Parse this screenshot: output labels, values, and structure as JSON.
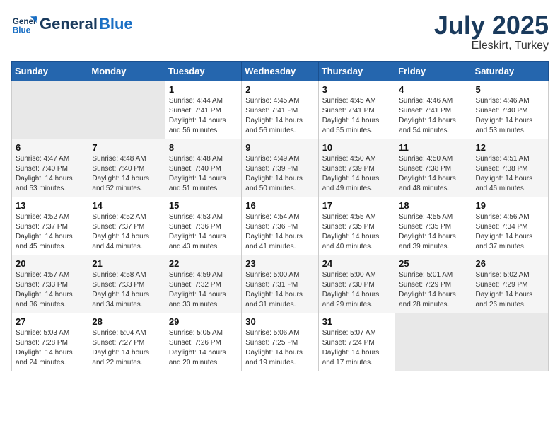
{
  "header": {
    "logo_line1": "General",
    "logo_line2": "Blue",
    "month": "July 2025",
    "location": "Eleskirt, Turkey"
  },
  "weekdays": [
    "Sunday",
    "Monday",
    "Tuesday",
    "Wednesday",
    "Thursday",
    "Friday",
    "Saturday"
  ],
  "weeks": [
    [
      {
        "day": "",
        "empty": true
      },
      {
        "day": "",
        "empty": true
      },
      {
        "day": "1",
        "sunrise": "4:44 AM",
        "sunset": "7:41 PM",
        "daylight": "14 hours and 56 minutes."
      },
      {
        "day": "2",
        "sunrise": "4:45 AM",
        "sunset": "7:41 PM",
        "daylight": "14 hours and 56 minutes."
      },
      {
        "day": "3",
        "sunrise": "4:45 AM",
        "sunset": "7:41 PM",
        "daylight": "14 hours and 55 minutes."
      },
      {
        "day": "4",
        "sunrise": "4:46 AM",
        "sunset": "7:41 PM",
        "daylight": "14 hours and 54 minutes."
      },
      {
        "day": "5",
        "sunrise": "4:46 AM",
        "sunset": "7:40 PM",
        "daylight": "14 hours and 53 minutes."
      }
    ],
    [
      {
        "day": "6",
        "sunrise": "4:47 AM",
        "sunset": "7:40 PM",
        "daylight": "14 hours and 53 minutes."
      },
      {
        "day": "7",
        "sunrise": "4:48 AM",
        "sunset": "7:40 PM",
        "daylight": "14 hours and 52 minutes."
      },
      {
        "day": "8",
        "sunrise": "4:48 AM",
        "sunset": "7:40 PM",
        "daylight": "14 hours and 51 minutes."
      },
      {
        "day": "9",
        "sunrise": "4:49 AM",
        "sunset": "7:39 PM",
        "daylight": "14 hours and 50 minutes."
      },
      {
        "day": "10",
        "sunrise": "4:50 AM",
        "sunset": "7:39 PM",
        "daylight": "14 hours and 49 minutes."
      },
      {
        "day": "11",
        "sunrise": "4:50 AM",
        "sunset": "7:38 PM",
        "daylight": "14 hours and 48 minutes."
      },
      {
        "day": "12",
        "sunrise": "4:51 AM",
        "sunset": "7:38 PM",
        "daylight": "14 hours and 46 minutes."
      }
    ],
    [
      {
        "day": "13",
        "sunrise": "4:52 AM",
        "sunset": "7:37 PM",
        "daylight": "14 hours and 45 minutes."
      },
      {
        "day": "14",
        "sunrise": "4:52 AM",
        "sunset": "7:37 PM",
        "daylight": "14 hours and 44 minutes."
      },
      {
        "day": "15",
        "sunrise": "4:53 AM",
        "sunset": "7:36 PM",
        "daylight": "14 hours and 43 minutes."
      },
      {
        "day": "16",
        "sunrise": "4:54 AM",
        "sunset": "7:36 PM",
        "daylight": "14 hours and 41 minutes."
      },
      {
        "day": "17",
        "sunrise": "4:55 AM",
        "sunset": "7:35 PM",
        "daylight": "14 hours and 40 minutes."
      },
      {
        "day": "18",
        "sunrise": "4:55 AM",
        "sunset": "7:35 PM",
        "daylight": "14 hours and 39 minutes."
      },
      {
        "day": "19",
        "sunrise": "4:56 AM",
        "sunset": "7:34 PM",
        "daylight": "14 hours and 37 minutes."
      }
    ],
    [
      {
        "day": "20",
        "sunrise": "4:57 AM",
        "sunset": "7:33 PM",
        "daylight": "14 hours and 36 minutes."
      },
      {
        "day": "21",
        "sunrise": "4:58 AM",
        "sunset": "7:33 PM",
        "daylight": "14 hours and 34 minutes."
      },
      {
        "day": "22",
        "sunrise": "4:59 AM",
        "sunset": "7:32 PM",
        "daylight": "14 hours and 33 minutes."
      },
      {
        "day": "23",
        "sunrise": "5:00 AM",
        "sunset": "7:31 PM",
        "daylight": "14 hours and 31 minutes."
      },
      {
        "day": "24",
        "sunrise": "5:00 AM",
        "sunset": "7:30 PM",
        "daylight": "14 hours and 29 minutes."
      },
      {
        "day": "25",
        "sunrise": "5:01 AM",
        "sunset": "7:29 PM",
        "daylight": "14 hours and 28 minutes."
      },
      {
        "day": "26",
        "sunrise": "5:02 AM",
        "sunset": "7:29 PM",
        "daylight": "14 hours and 26 minutes."
      }
    ],
    [
      {
        "day": "27",
        "sunrise": "5:03 AM",
        "sunset": "7:28 PM",
        "daylight": "14 hours and 24 minutes."
      },
      {
        "day": "28",
        "sunrise": "5:04 AM",
        "sunset": "7:27 PM",
        "daylight": "14 hours and 22 minutes."
      },
      {
        "day": "29",
        "sunrise": "5:05 AM",
        "sunset": "7:26 PM",
        "daylight": "14 hours and 20 minutes."
      },
      {
        "day": "30",
        "sunrise": "5:06 AM",
        "sunset": "7:25 PM",
        "daylight": "14 hours and 19 minutes."
      },
      {
        "day": "31",
        "sunrise": "5:07 AM",
        "sunset": "7:24 PM",
        "daylight": "14 hours and 17 minutes."
      },
      {
        "day": "",
        "empty": true
      },
      {
        "day": "",
        "empty": true
      }
    ]
  ],
  "labels": {
    "sunrise": "Sunrise:",
    "sunset": "Sunset:",
    "daylight": "Daylight:"
  }
}
